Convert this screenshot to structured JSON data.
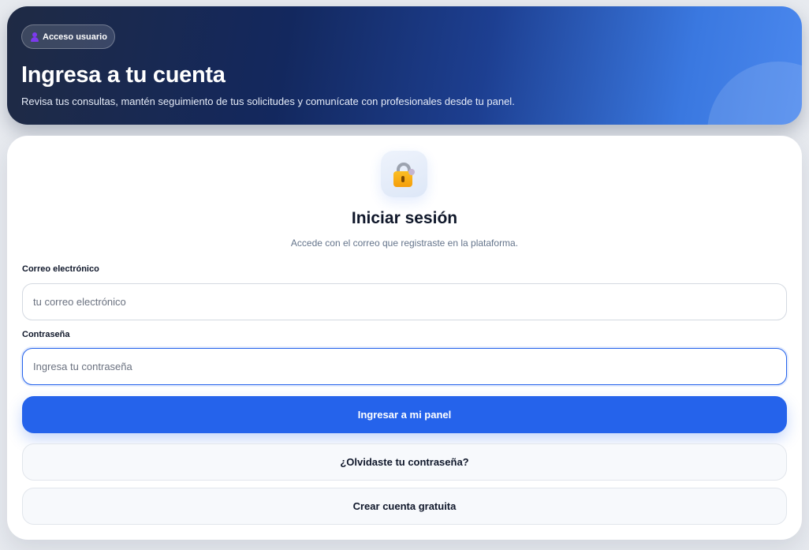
{
  "hero": {
    "badge_label": "Acceso usuario",
    "title": "Ingresa a tu cuenta",
    "subtitle": "Revisa tus consultas, mantén seguimiento de tus solicitudes y comunícate con profesionales desde tu panel."
  },
  "login": {
    "title": "Iniciar sesión",
    "subtitle": "Accede con el correo que registraste en la plataforma.",
    "email": {
      "label": "Correo electrónico",
      "placeholder": "tu correo electrónico",
      "value": ""
    },
    "password": {
      "label": "Contraseña",
      "placeholder": "Ingresa tu contraseña",
      "value": "",
      "focused": true
    },
    "submit_label": "Ingresar a mi panel",
    "forgot_label": "¿Olvidaste tu contraseña?",
    "register_label": "Crear cuenta gratuita"
  },
  "icons": {
    "badge": "user-icon",
    "card": "lock-icon"
  },
  "colors": {
    "accent": "#2563eb",
    "hero_dark": "#13285e",
    "hero_light": "#4b88ee",
    "text": "#0f172a",
    "muted": "#64748b"
  }
}
